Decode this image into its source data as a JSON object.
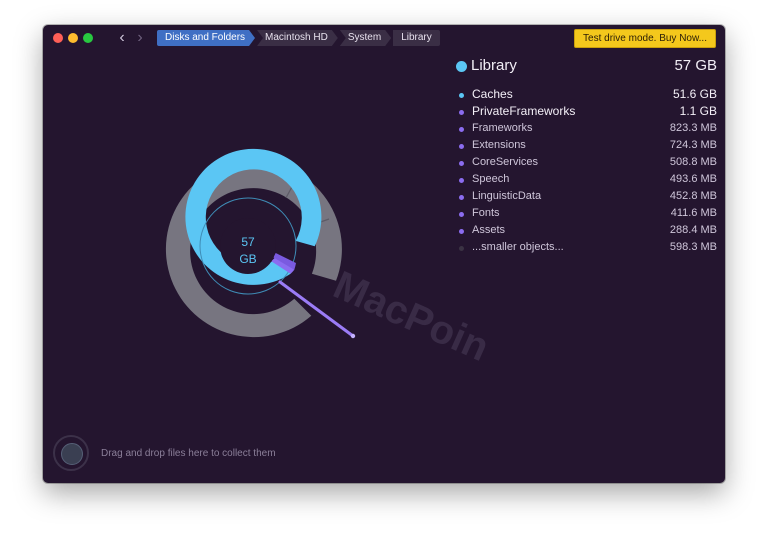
{
  "toolbar": {
    "back_icon": "chevron-left-icon",
    "forward_icon": "chevron-right-icon",
    "breadcrumb": [
      "Disks and Folders",
      "Macintosh HD",
      "System",
      "Library"
    ],
    "buy_label": "Test drive mode. Buy Now..."
  },
  "chart": {
    "center_value": "57",
    "center_unit": "GB",
    "sunburst_icon": "sunburst-chart"
  },
  "panel": {
    "title": "Library",
    "size": "57 GB",
    "items": [
      {
        "name": "Caches",
        "size": "51.6 GB",
        "color": "#5bc6f4"
      },
      {
        "name": "PrivateFrameworks",
        "size": "1.1 GB",
        "color": "#8b6cf0"
      },
      {
        "name": "Frameworks",
        "size": "823.3 MB",
        "color": "#8b6cf0"
      },
      {
        "name": "Extensions",
        "size": "724.3 MB",
        "color": "#8b6cf0"
      },
      {
        "name": "CoreServices",
        "size": "508.8 MB",
        "color": "#8b6cf0"
      },
      {
        "name": "Speech",
        "size": "493.6 MB",
        "color": "#8b6cf0"
      },
      {
        "name": "LinguisticData",
        "size": "452.8 MB",
        "color": "#8b6cf0"
      },
      {
        "name": "Fonts",
        "size": "411.6 MB",
        "color": "#8b6cf0"
      },
      {
        "name": "Assets",
        "size": "288.4 MB",
        "color": "#8b6cf0"
      },
      {
        "name": "...smaller objects...",
        "size": "598.3 MB",
        "color": "#3b3344"
      }
    ]
  },
  "watermark": "MacPoin",
  "footer": {
    "drop_text": "Drag and drop files here to collect them"
  },
  "colors": {
    "background": "#24152f",
    "caches": "#5bc6f4",
    "frameworks": "#8b6cf0",
    "outer_ring": "#777580",
    "accent": "#3f6fc4"
  }
}
